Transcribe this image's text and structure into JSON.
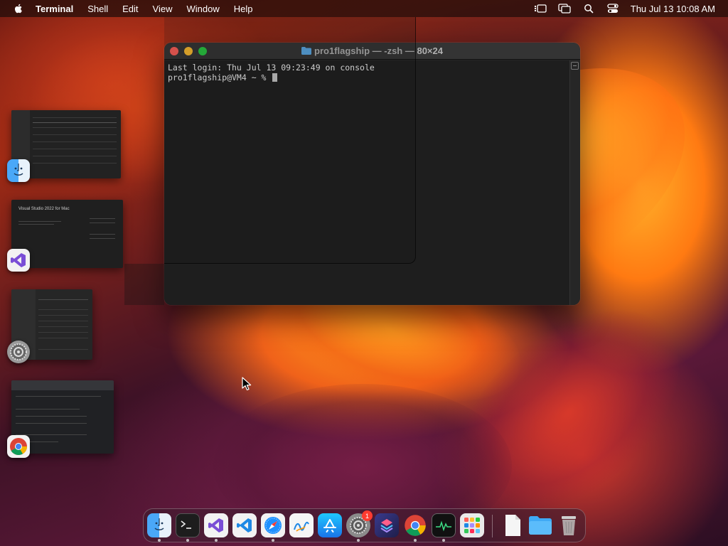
{
  "menubar": {
    "app_name": "Terminal",
    "menus": [
      "Shell",
      "Edit",
      "View",
      "Window",
      "Help"
    ],
    "clock": "Thu Jul 13  10:08 AM",
    "status_icons": [
      "stage-manager-icon",
      "screen-mirroring-icon",
      "spotlight-search-icon",
      "control-center-icon"
    ]
  },
  "terminal": {
    "title": "pro1flagship — -zsh — 80×24",
    "lines": [
      "Last login: Thu Jul 13 09:23:49 on console",
      "pro1flagship@VM4 ~ % "
    ]
  },
  "stage_manager": {
    "thumbs": [
      {
        "app": "Finder",
        "icon": "finder-icon"
      },
      {
        "app": "Visual Studio",
        "icon": "visual-studio-icon",
        "thumb_title": "Visual Studio 2022 for Mac"
      },
      {
        "app": "System Settings",
        "icon": "system-settings-icon"
      },
      {
        "app": "Google Chrome",
        "icon": "chrome-icon"
      }
    ]
  },
  "dock": {
    "items": [
      {
        "name": "Finder",
        "icon": "finder-icon",
        "running": true
      },
      {
        "name": "Terminal",
        "icon": "terminal-icon",
        "running": true
      },
      {
        "name": "Visual Studio",
        "icon": "visual-studio-icon",
        "running": true
      },
      {
        "name": "Visual Studio Code",
        "icon": "vscode-icon",
        "running": false
      },
      {
        "name": "Safari",
        "icon": "safari-icon",
        "running": true
      },
      {
        "name": "Freeform",
        "icon": "freeform-icon",
        "running": false
      },
      {
        "name": "App Store",
        "icon": "app-store-icon",
        "running": false
      },
      {
        "name": "System Settings",
        "icon": "system-settings-icon",
        "running": true,
        "badge": "1"
      },
      {
        "name": "Shortcuts",
        "icon": "shortcuts-icon",
        "running": false
      },
      {
        "name": "Google Chrome",
        "icon": "chrome-icon",
        "running": true
      },
      {
        "name": "Activity Monitor",
        "icon": "activity-monitor-icon",
        "running": true
      },
      {
        "name": "Launchpad",
        "icon": "launchpad-icon",
        "running": false
      },
      {
        "name": "Document",
        "icon": "document-icon",
        "running": false
      },
      {
        "name": "Downloads",
        "icon": "folder-icon",
        "running": false
      },
      {
        "name": "Trash",
        "icon": "trash-icon",
        "running": false
      }
    ]
  },
  "colors": {
    "terminal_bg": "#1e1e1e",
    "traffic_close": "#ff5f57",
    "traffic_min": "#febc2e",
    "traffic_max": "#28c840",
    "badge": "#ff3b30"
  }
}
